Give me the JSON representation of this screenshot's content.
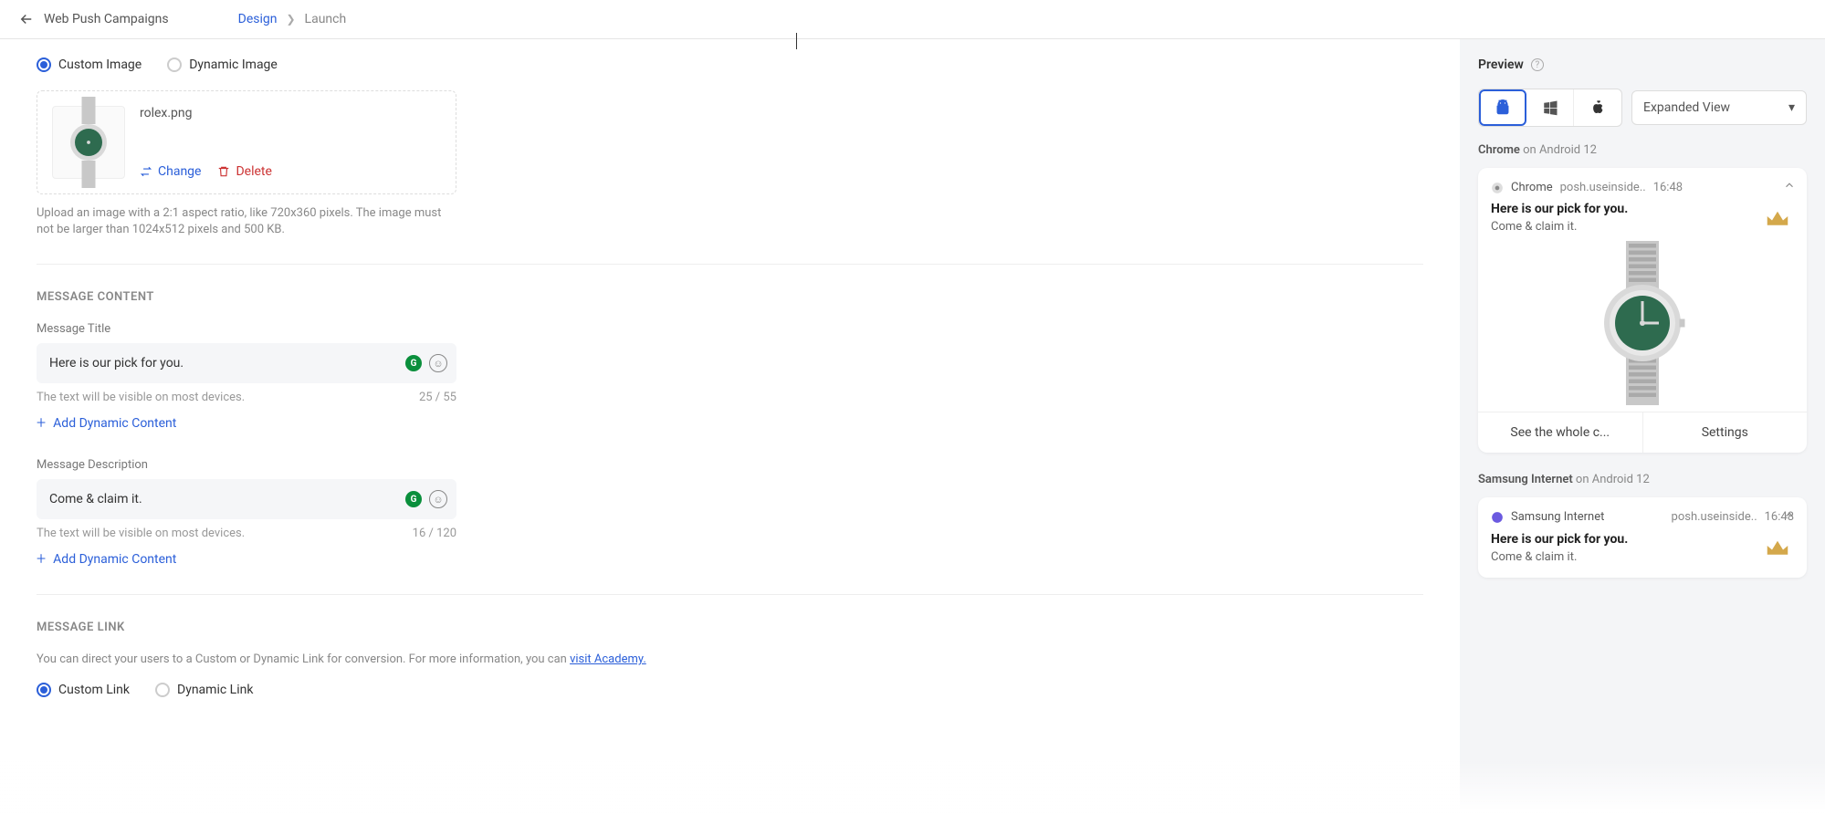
{
  "topbar": {
    "back_label": "Web Push Campaigns",
    "crumb_design": "Design",
    "crumb_launch": "Launch"
  },
  "image": {
    "radio_custom": "Custom Image",
    "radio_dynamic": "Dynamic Image",
    "filename": "rolex.png",
    "change": "Change",
    "delete": "Delete",
    "helper": "Upload an image with a 2:1 aspect ratio, like 720x360 pixels. The image must not be larger than 1024x512 pixels and 500 KB."
  },
  "content": {
    "heading": "MESSAGE CONTENT",
    "title_label": "Message Title",
    "title_value": "Here is our pick for you.",
    "title_hint": "The text will be visible on most devices.",
    "title_counter": "25 / 55",
    "desc_label": "Message Description",
    "desc_value": "Come & claim it.",
    "desc_hint": "The text will be visible on most devices.",
    "desc_counter": "16 / 120",
    "add_dynamic": "Add Dynamic Content"
  },
  "link": {
    "heading": "MESSAGE LINK",
    "desc_pre": "You can direct your users to a Custom or Dynamic Link for conversion. For more information, you can ",
    "desc_link": "visit Academy.",
    "radio_custom": "Custom Link",
    "radio_dynamic": "Dynamic Link"
  },
  "preview": {
    "title": "Preview",
    "view_mode": "Expanded View",
    "chrome_line_browser": "Chrome",
    "chrome_line_rest": " on Android 12",
    "samsung_line_browser": "Samsung Internet",
    "samsung_line_rest": " on Android 12",
    "notif": {
      "chrome_name": "Chrome",
      "samsung_name": "Samsung Internet",
      "domain": "posh.useinside..",
      "time": "16:48",
      "title": "Here is our pick for you.",
      "desc": "Come & claim it.",
      "action1": "See the whole c...",
      "action2": "Settings"
    }
  }
}
